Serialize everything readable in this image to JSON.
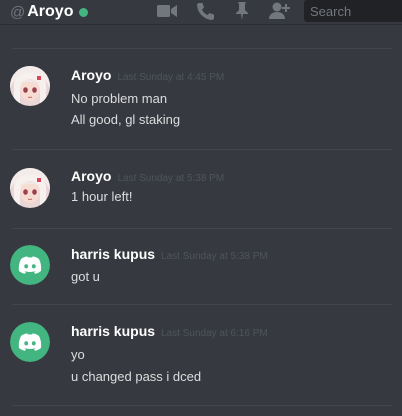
{
  "header": {
    "at_symbol": "@",
    "channel_name": "Aroyo",
    "search_placeholder": "Search",
    "icons": [
      "video-call-icon",
      "phone-icon",
      "pin-icon",
      "add-member-icon"
    ]
  },
  "colors": {
    "background": "#36393f",
    "online": "#43b581",
    "discord_blurple": "#43b581"
  },
  "messages": [
    {
      "author": "Aroyo",
      "timestamp": "Last Sunday at 4:45 PM",
      "avatar": "anime-avatar",
      "lines": [
        "No problem man",
        "All good, gl staking"
      ]
    },
    {
      "author": "Aroyo",
      "timestamp": "Last Sunday at 5:38 PM",
      "avatar": "anime-avatar",
      "lines": [
        "1 hour left!"
      ]
    },
    {
      "author": "harris kupus",
      "timestamp": "Last Sunday at 5:38 PM",
      "avatar": "discord-default-avatar",
      "lines": [
        "got u"
      ]
    },
    {
      "author": "harris kupus",
      "timestamp": "Last Sunday at 6:16 PM",
      "avatar": "discord-default-avatar",
      "lines": [
        "yo",
        "u changed pass  i dced"
      ]
    }
  ]
}
